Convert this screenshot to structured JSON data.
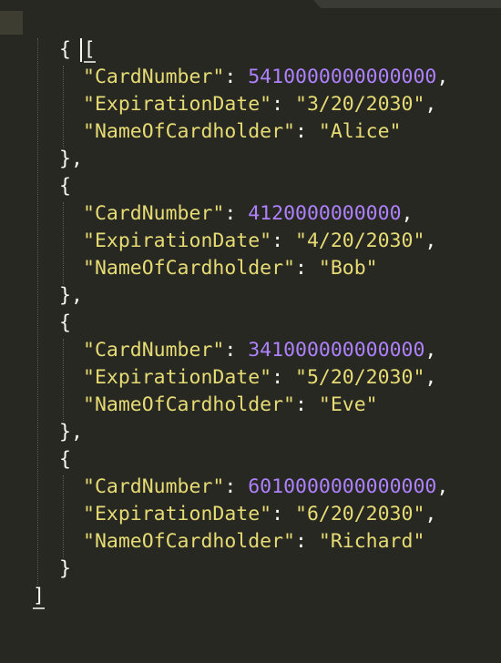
{
  "open_bracket": "[",
  "close_bracket": "]",
  "open_brace": "{",
  "close_brace": "}",
  "close_brace_comma": "},",
  "colon": ": ",
  "comma": ",",
  "keys": {
    "card_number": "\"CardNumber\"",
    "expiration_date": "\"ExpirationDate\"",
    "name_of_cardholder": "\"NameOfCardholder\""
  },
  "records": [
    {
      "card_number": "5410000000000000",
      "expiration_date": "\"3/20/2030\"",
      "name_of_cardholder": "\"Alice\""
    },
    {
      "card_number": "4120000000000",
      "expiration_date": "\"4/20/2030\"",
      "name_of_cardholder": "\"Bob\""
    },
    {
      "card_number": "341000000000000",
      "expiration_date": "\"5/20/2030\"",
      "name_of_cardholder": "\"Eve\""
    },
    {
      "card_number": "6010000000000000",
      "expiration_date": "\"6/20/2030\"",
      "name_of_cardholder": "\"Richard\""
    }
  ],
  "colors": {
    "background": "#272822",
    "string": "#e6db74",
    "number": "#ae81ff",
    "punctuation": "#f8f8f2"
  }
}
